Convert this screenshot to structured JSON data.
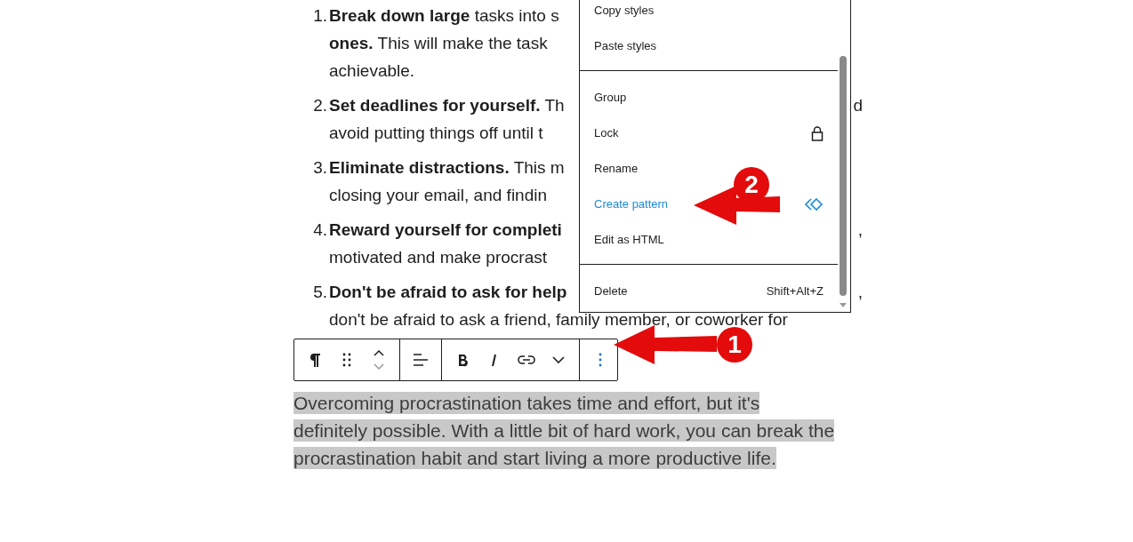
{
  "list_items": [
    {
      "number": "1.",
      "lines": [
        {
          "text": "**Break down large** tasks into s"
        },
        {
          "text": "**ones.** This will make the task"
        },
        {
          "text": "achievable."
        }
      ]
    },
    {
      "number": "2.",
      "lines": [
        {
          "text": "**Set deadlines for yourself.** Th",
          "tail": "d"
        },
        {
          "text": "avoid putting things off until t"
        }
      ]
    },
    {
      "number": "3.",
      "lines": [
        {
          "text": "**Eliminate distractions.** This m"
        },
        {
          "text": "closing your email, and findin"
        }
      ]
    },
    {
      "number": "4.",
      "lines": [
        {
          "text": "**Reward yourself for completi**",
          "tail": ","
        },
        {
          "text": "motivated and make procrast"
        }
      ]
    },
    {
      "number": "5.",
      "lines": [
        {
          "text": "**Don't be afraid to ask for help**",
          "tail": ","
        },
        {
          "text": "don't be afraid to ask a friend, family member, or coworker for"
        }
      ]
    }
  ],
  "toolbar": {
    "groups": [
      [
        {
          "kind": "paragraph"
        },
        {
          "kind": "drag"
        },
        {
          "kind": "move"
        }
      ],
      [
        {
          "kind": "align"
        }
      ],
      [
        {
          "kind": "bold"
        },
        {
          "kind": "italic"
        },
        {
          "kind": "link"
        },
        {
          "kind": "dropdown"
        }
      ],
      [
        {
          "kind": "options"
        }
      ]
    ]
  },
  "paragraph": {
    "selected": true,
    "lines": [
      "Overcoming procrastination takes time and effort, but it's",
      "definitely possible. With a little bit of hard work, you can break the",
      "procrastination habit and start living a more productive life."
    ]
  },
  "menu": {
    "sections": [
      [
        {
          "label": "Copy styles",
          "highlighted": false
        },
        {
          "label": "Paste styles",
          "highlighted": false
        }
      ],
      [
        {
          "label": "Group",
          "highlighted": false
        },
        {
          "label": "Lock",
          "highlighted": false,
          "kind": "lock"
        },
        {
          "label": "Rename",
          "highlighted": false
        },
        {
          "label": "Create pattern",
          "highlighted": true,
          "kind": "pattern"
        },
        {
          "label": "Edit as HTML",
          "highlighted": false
        }
      ],
      [
        {
          "label": "Delete",
          "highlighted": false,
          "shortcut": "Shift+Alt+Z"
        }
      ]
    ]
  },
  "annotations": [
    {
      "number": "1"
    },
    {
      "number": "2"
    }
  ]
}
